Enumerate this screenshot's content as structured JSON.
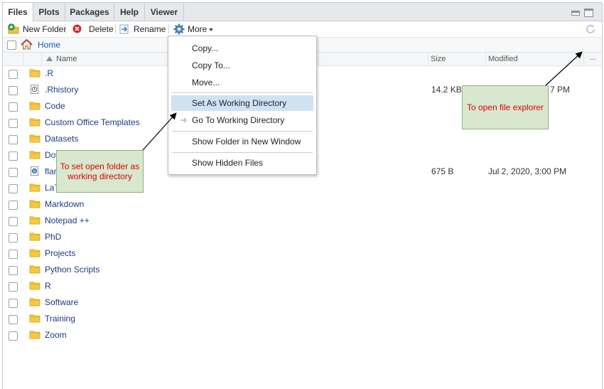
{
  "tabs": [
    "Files",
    "Plots",
    "Packages",
    "Help",
    "Viewer"
  ],
  "toolbar": {
    "new_folder": "New Folder",
    "delete": "Delete",
    "rename": "Rename",
    "more": "More"
  },
  "breadcrumb": {
    "home": "Home"
  },
  "header": {
    "name": "Name",
    "size": "Size",
    "modified": "Modified",
    "more": "..."
  },
  "files": [
    {
      "name": ".R",
      "size": "",
      "modified": "",
      "type": "folder"
    },
    {
      "name": ".Rhistory",
      "size": "14.2 KB",
      "modified": "7 PM",
      "type": "history"
    },
    {
      "name": "Code",
      "size": "",
      "modified": "",
      "type": "folder"
    },
    {
      "name": "Custom Office Templates",
      "size": "",
      "modified": "",
      "type": "folder"
    },
    {
      "name": "Datasets",
      "size": "",
      "modified": "",
      "type": "folder"
    },
    {
      "name": "Dov",
      "size": "",
      "modified": "",
      "type": "folder"
    },
    {
      "name": "flam",
      "size": "675 B",
      "modified": "Jul 2, 2020, 3:00 PM",
      "type": "rfile"
    },
    {
      "name": "LaT",
      "size": "",
      "modified": "",
      "type": "folder"
    },
    {
      "name": "Markdown",
      "size": "",
      "modified": "",
      "type": "folder"
    },
    {
      "name": "Notepad ++",
      "size": "",
      "modified": "",
      "type": "folder"
    },
    {
      "name": "PhD",
      "size": "",
      "modified": "",
      "type": "folder"
    },
    {
      "name": "Projects",
      "size": "",
      "modified": "",
      "type": "folder"
    },
    {
      "name": "Python Scripts",
      "size": "",
      "modified": "",
      "type": "folder"
    },
    {
      "name": "R",
      "size": "",
      "modified": "",
      "type": "folder"
    },
    {
      "name": "Software",
      "size": "",
      "modified": "",
      "type": "folder"
    },
    {
      "name": "Training",
      "size": "",
      "modified": "",
      "type": "folder"
    },
    {
      "name": "Zoom",
      "size": "",
      "modified": "",
      "type": "folder"
    }
  ],
  "menu": {
    "copy": "Copy...",
    "copy_to": "Copy To...",
    "move": "Move...",
    "set_wd": "Set As Working Directory",
    "go_wd": "Go To Working Directory",
    "show_folder": "Show Folder in New Window",
    "show_hidden": "Show Hidden Files"
  },
  "annotations": {
    "working_dir": "To set open folder as working directory",
    "file_explorer": "To open file explorer"
  },
  "colors": {
    "annotation_bg": "#d8e8cf",
    "annotation_text": "#e00000",
    "highlight": "#cfe2f3",
    "link": "#1a3c82"
  }
}
